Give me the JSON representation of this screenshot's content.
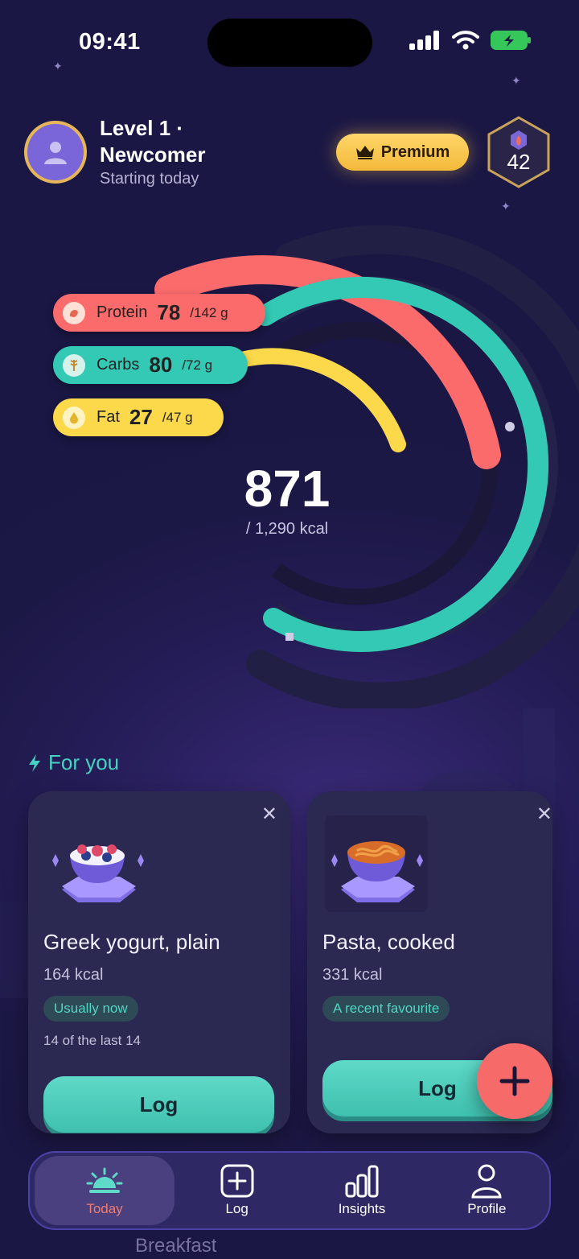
{
  "status_bar": {
    "time": "09:41"
  },
  "header": {
    "level_title": "Level 1 · Newcomer",
    "level_subtitle": "Starting today",
    "premium_label": "Premium",
    "badge_value": "42"
  },
  "macros": {
    "protein": {
      "label": "Protein",
      "value": "78",
      "goal": "/142 g",
      "fraction": 0.55
    },
    "carbs": {
      "label": "Carbs",
      "value": "80",
      "goal": "/72 g",
      "fraction": 1.11
    },
    "fat": {
      "label": "Fat",
      "value": "27",
      "goal": "/47 g",
      "fraction": 0.57
    }
  },
  "calories": {
    "value": "871",
    "goal": "/ 1,290 kcal",
    "fraction": 0.675
  },
  "for_you": {
    "title": "For you",
    "cards": [
      {
        "name": "Greek yogurt, plain",
        "kcal": "164 kcal",
        "tag": "Usually now",
        "note": "14 of the last 14",
        "button": "Log"
      },
      {
        "name": "Pasta, cooked",
        "kcal": "331 kcal",
        "tag": "A recent favourite",
        "button": "Log"
      }
    ]
  },
  "behind_nav": {
    "text": "Breakfast"
  },
  "nav": {
    "items": [
      {
        "label": "Today",
        "icon": "sunrise-icon",
        "active": true
      },
      {
        "label": "Log",
        "icon": "plus-square-icon"
      },
      {
        "label": "Insights",
        "icon": "bar-chart-icon"
      },
      {
        "label": "Profile",
        "icon": "person-icon"
      }
    ]
  },
  "colors": {
    "protein": "#fb6b6c",
    "carbs": "#34c9b4",
    "fat": "#fcd94a",
    "accent": "#45d2c2",
    "premium": "#f7c44c",
    "fab": "#f76a6a",
    "background": "#1c1846"
  }
}
